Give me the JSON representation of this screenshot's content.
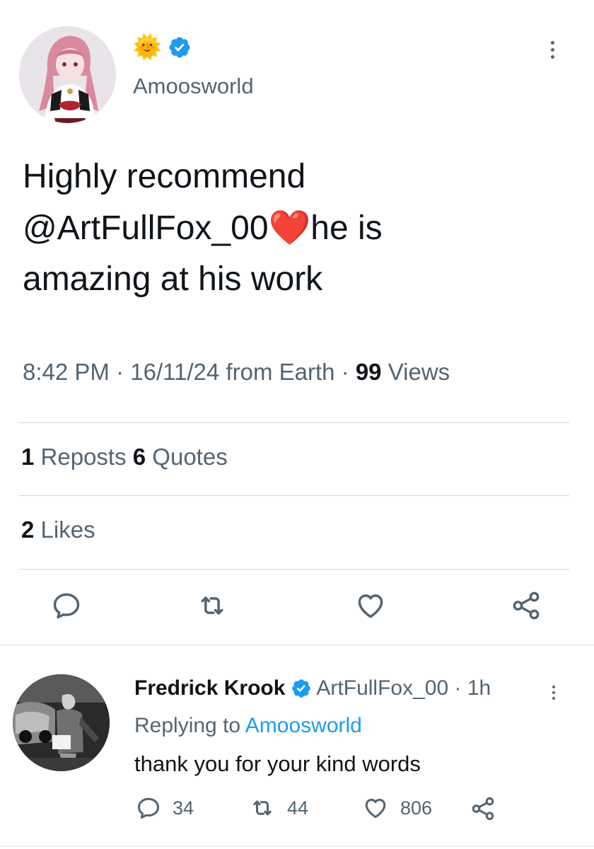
{
  "author": {
    "emoji": "🌞",
    "handle": "Amoosworld"
  },
  "tweet": {
    "text_part1": "Highly recommend\n@ArtFullFox_00",
    "heart": "❤️",
    "text_part2": "he is\namazing at his work",
    "time": "8:42 PM",
    "date": "16/11/24",
    "source": "from Earth",
    "views_count": "99",
    "views_label": "Views"
  },
  "stats": {
    "reposts_count": "1",
    "reposts_label": "Reposts",
    "quotes_count": "6",
    "quotes_label": "Quotes",
    "likes_count": "2",
    "likes_label": "Likes"
  },
  "reply": {
    "name": "Fredrick Krook",
    "handle": "ArtFullFox_00",
    "time": "1h",
    "replying_label": "Replying to",
    "replying_to": "Amoosworld",
    "text": "thank you for your kind words",
    "reply_count": "34",
    "repost_count": "44",
    "like_count": "806"
  },
  "colors": {
    "accent": "#1d9bf0",
    "secondary_text": "#536471",
    "primary_text": "#0f1419",
    "heart": "#e0245e",
    "divider": "#cfd9de"
  },
  "icons": {
    "reply": "comment-icon",
    "repost": "repost-icon",
    "like": "heart-icon",
    "share": "share-icon",
    "verified": "verified-badge-icon",
    "more": "more-vertical-icon"
  }
}
